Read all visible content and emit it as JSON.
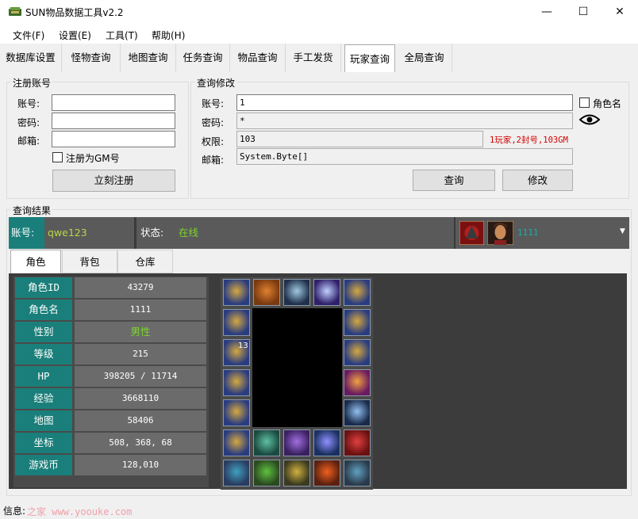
{
  "window": {
    "title": "SUN物品数据工具v2.2",
    "minimize": "—",
    "maximize": "☐",
    "close": "✕"
  },
  "menu": [
    "文件(F)",
    "设置(E)",
    "工具(T)",
    "帮助(H)"
  ],
  "tabs": [
    "数据库设置",
    "怪物查询",
    "地图查询",
    "任务查询",
    "物品查询",
    "手工发货",
    "玩家查询",
    "全局查询"
  ],
  "register": {
    "title": "注册账号",
    "account_label": "账号:",
    "password_label": "密码:",
    "email_label": "邮箱:",
    "account_value": "",
    "password_value": "",
    "email_value": "",
    "gm_checkbox": "注册为GM号",
    "gm_checked": false,
    "submit": "立刻注册"
  },
  "query": {
    "title": "查询修改",
    "account_label": "账号:",
    "account_value": "1",
    "password_label": "密码:",
    "password_value": "*",
    "perm_label": "权限:",
    "perm_value": "103",
    "perm_hint": "1玩家,2封号,103GM",
    "email_label": "邮箱:",
    "email_value": "System.Byte[]",
    "role_checkbox": "角色名",
    "role_checked": false,
    "query_button": "查询",
    "modify_button": "修改"
  },
  "result": {
    "title": "查询结果",
    "account_label": "账号:",
    "account_value": "qwe123",
    "status_label": "状态:",
    "status_value": "在线",
    "char_name": "1111"
  },
  "inner_tabs": [
    "角色",
    "背包",
    "仓库"
  ],
  "character": [
    {
      "label": "角色ID",
      "value": "43279"
    },
    {
      "label": "角色名",
      "value": "1111"
    },
    {
      "label": "性别",
      "value": "男性"
    },
    {
      "label": "等级",
      "value": "215"
    },
    {
      "label": "HP",
      "value": "398205 / 11714"
    },
    {
      "label": "经验",
      "value": "3668110"
    },
    {
      "label": "地图",
      "value": "58406"
    },
    {
      "label": "坐标",
      "value": "508, 368, 68"
    },
    {
      "label": "游戏币",
      "value": "128,010"
    }
  ],
  "equip_stack": "13",
  "status": {
    "label": "信息:",
    "watermark": "之家 www.yoouke.com"
  },
  "colors": {
    "teal": "#1a7f7a",
    "green_text": "#b8d64a",
    "red_hint": "#d40000",
    "panel": "#3c3c3c"
  }
}
